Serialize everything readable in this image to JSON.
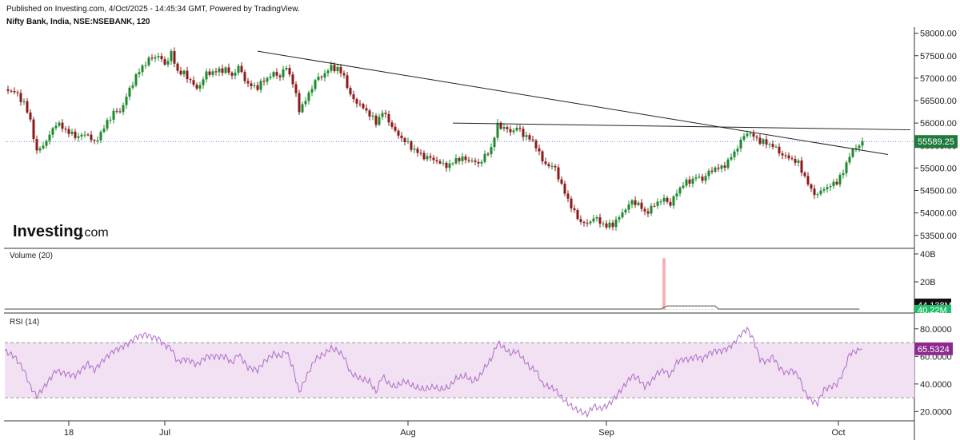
{
  "header": {
    "published": "Published on Investing.com, 4/Oct/2025 - 14:45:34 GMT, Powered by TradingView.",
    "symbol": "Nifty Bank, India, NSE:NSEBANK, 120"
  },
  "brand": {
    "name": "Investing",
    "suffix": ".com"
  },
  "colors": {
    "up": "#1e8a2e",
    "down": "#8b1a1a",
    "rsi_line": "#b06cc7",
    "rsi_band": "#f1e1f3",
    "price_line": "#3b6fd6",
    "last_price_bg": "#1e7b3a",
    "rsi_badge_bg": "#8e2a8e",
    "vol_badge_bg": "#111111",
    "vol_badge2_bg": "#1fbf6a",
    "volume_spike": "#f4b3b3"
  },
  "chart_data": [
    {
      "type": "candlestick",
      "title": "Nifty Bank, India, NSE:NSEBANK, 120",
      "ylim": [
        53300,
        58100
      ],
      "yticks": [
        "58000.00",
        "57500.00",
        "57000.00",
        "56500.00",
        "56000.00",
        "55500.00",
        "55000.00",
        "54500.00",
        "54000.00",
        "53500.00"
      ],
      "ytick_values": [
        58000,
        57500,
        57000,
        56500,
        56000,
        55500,
        55000,
        54500,
        54000,
        53500
      ],
      "last_price": 55589.25,
      "last_price_label": "55589.25",
      "close_path": [
        [
          0,
          56750
        ],
        [
          6,
          56700
        ],
        [
          12,
          56450
        ],
        [
          16,
          56050
        ],
        [
          20,
          55350
        ],
        [
          26,
          55600
        ],
        [
          32,
          56000
        ],
        [
          36,
          55900
        ],
        [
          44,
          55700
        ],
        [
          52,
          55750
        ],
        [
          56,
          55550
        ],
        [
          62,
          55900
        ],
        [
          68,
          56250
        ],
        [
          72,
          56250
        ],
        [
          78,
          56750
        ],
        [
          82,
          57050
        ],
        [
          88,
          57350
        ],
        [
          92,
          57450
        ],
        [
          96,
          57500
        ],
        [
          100,
          57300
        ],
        [
          104,
          57550
        ],
        [
          108,
          57150
        ],
        [
          112,
          57100
        ],
        [
          116,
          56950
        ],
        [
          120,
          56750
        ],
        [
          126,
          57100
        ],
        [
          132,
          57150
        ],
        [
          138,
          57200
        ],
        [
          142,
          57050
        ],
        [
          146,
          57250
        ],
        [
          152,
          56850
        ],
        [
          158,
          56800
        ],
        [
          162,
          56950
        ],
        [
          168,
          57100
        ],
        [
          172,
          57050
        ],
        [
          176,
          57250
        ],
        [
          180,
          56900
        ],
        [
          184,
          56300
        ],
        [
          188,
          56500
        ],
        [
          194,
          56950
        ],
        [
          200,
          57100
        ],
        [
          204,
          57250
        ],
        [
          208,
          57200
        ],
        [
          212,
          57050
        ],
        [
          216,
          56600
        ],
        [
          222,
          56400
        ],
        [
          228,
          56200
        ],
        [
          232,
          56000
        ],
        [
          236,
          56250
        ],
        [
          240,
          56050
        ],
        [
          244,
          55800
        ],
        [
          250,
          55600
        ],
        [
          256,
          55400
        ],
        [
          262,
          55250
        ],
        [
          268,
          55200
        ],
        [
          272,
          55100
        ],
        [
          278,
          55050
        ],
        [
          282,
          55200
        ],
        [
          288,
          55200
        ],
        [
          292,
          55150
        ],
        [
          296,
          55100
        ],
        [
          300,
          55250
        ],
        [
          304,
          55450
        ],
        [
          308,
          55950
        ],
        [
          312,
          55900
        ],
        [
          316,
          55800
        ],
        [
          320,
          55900
        ],
        [
          324,
          55750
        ],
        [
          328,
          55650
        ],
        [
          332,
          55500
        ],
        [
          336,
          55150
        ],
        [
          340,
          55050
        ],
        [
          344,
          55000
        ],
        [
          348,
          54600
        ],
        [
          352,
          54300
        ],
        [
          356,
          54000
        ],
        [
          360,
          53800
        ],
        [
          364,
          53750
        ],
        [
          368,
          53900
        ],
        [
          372,
          53800
        ],
        [
          376,
          53700
        ],
        [
          380,
          53750
        ],
        [
          384,
          53900
        ],
        [
          388,
          54100
        ],
        [
          392,
          54250
        ],
        [
          396,
          54200
        ],
        [
          400,
          54000
        ],
        [
          404,
          54100
        ],
        [
          408,
          54250
        ],
        [
          412,
          54300
        ],
        [
          416,
          54200
        ],
        [
          420,
          54450
        ],
        [
          424,
          54650
        ],
        [
          428,
          54700
        ],
        [
          432,
          54800
        ],
        [
          436,
          54750
        ],
        [
          440,
          54900
        ],
        [
          444,
          55000
        ],
        [
          448,
          55000
        ],
        [
          452,
          55150
        ],
        [
          456,
          55350
        ],
        [
          460,
          55600
        ],
        [
          464,
          55800
        ],
        [
          468,
          55700
        ],
        [
          472,
          55600
        ],
        [
          476,
          55550
        ],
        [
          480,
          55500
        ],
        [
          484,
          55350
        ],
        [
          488,
          55250
        ],
        [
          492,
          55200
        ],
        [
          496,
          55100
        ],
        [
          500,
          54800
        ],
        [
          504,
          54500
        ],
        [
          508,
          54400
        ],
        [
          512,
          54550
        ],
        [
          516,
          54600
        ],
        [
          520,
          54700
        ],
        [
          524,
          54900
        ],
        [
          528,
          55300
        ],
        [
          532,
          55450
        ],
        [
          536,
          55589
        ]
      ],
      "trendlines": [
        {
          "name": "descending-resistance",
          "from": [
            158,
            57600
          ],
          "to": [
            552,
            55300
          ]
        },
        {
          "name": "horizontal-resistance",
          "from": [
            280,
            56000
          ],
          "to": [
            566,
            55850
          ]
        }
      ]
    },
    {
      "type": "bar",
      "title": "Volume (20)",
      "ylim": [
        0,
        40
      ],
      "yticks": [
        "40B",
        "20B"
      ],
      "ytick_values": [
        40,
        20
      ],
      "unit": "B",
      "spike_x": 412,
      "spike_value": 37,
      "ma_step": [
        [
          0,
          0.6
        ],
        [
          410,
          0.6
        ],
        [
          414,
          2.8
        ],
        [
          444,
          2.8
        ],
        [
          446,
          0.6
        ],
        [
          534,
          0.6
        ]
      ],
      "last_volume": "44.138M",
      "volume_ma": "40.22M"
    },
    {
      "type": "line",
      "title": "RSI (14)",
      "ylim": [
        15,
        88
      ],
      "yticks": [
        "80.0000",
        "60.0000",
        "40.0000",
        "20.0000"
      ],
      "ytick_values": [
        80,
        60,
        40,
        20
      ],
      "band": [
        30,
        70
      ],
      "last_value": 65.5324,
      "last_value_label": "65.5324",
      "values": [
        [
          0,
          64
        ],
        [
          6,
          60
        ],
        [
          12,
          50
        ],
        [
          16,
          38
        ],
        [
          20,
          31
        ],
        [
          26,
          40
        ],
        [
          32,
          50
        ],
        [
          36,
          48
        ],
        [
          44,
          46
        ],
        [
          52,
          55
        ],
        [
          56,
          50
        ],
        [
          62,
          58
        ],
        [
          68,
          64
        ],
        [
          72,
          66
        ],
        [
          78,
          70
        ],
        [
          82,
          74
        ],
        [
          88,
          76
        ],
        [
          92,
          74
        ],
        [
          96,
          73
        ],
        [
          100,
          68
        ],
        [
          104,
          66
        ],
        [
          108,
          56
        ],
        [
          112,
          58
        ],
        [
          116,
          57
        ],
        [
          120,
          54
        ],
        [
          126,
          60
        ],
        [
          132,
          60
        ],
        [
          138,
          60
        ],
        [
          142,
          55
        ],
        [
          146,
          62
        ],
        [
          152,
          52
        ],
        [
          158,
          50
        ],
        [
          162,
          56
        ],
        [
          168,
          62
        ],
        [
          172,
          60
        ],
        [
          176,
          64
        ],
        [
          180,
          52
        ],
        [
          184,
          34
        ],
        [
          188,
          44
        ],
        [
          194,
          58
        ],
        [
          200,
          62
        ],
        [
          204,
          66
        ],
        [
          208,
          64
        ],
        [
          212,
          60
        ],
        [
          216,
          48
        ],
        [
          222,
          44
        ],
        [
          228,
          42
        ],
        [
          232,
          34
        ],
        [
          236,
          46
        ],
        [
          240,
          40
        ],
        [
          244,
          38
        ],
        [
          250,
          42
        ],
        [
          256,
          38
        ],
        [
          262,
          36
        ],
        [
          268,
          38
        ],
        [
          272,
          36
        ],
        [
          278,
          38
        ],
        [
          282,
          44
        ],
        [
          288,
          46
        ],
        [
          292,
          42
        ],
        [
          296,
          44
        ],
        [
          300,
          52
        ],
        [
          304,
          58
        ],
        [
          308,
          70
        ],
        [
          312,
          66
        ],
        [
          316,
          62
        ],
        [
          320,
          64
        ],
        [
          324,
          58
        ],
        [
          328,
          52
        ],
        [
          332,
          50
        ],
        [
          336,
          40
        ],
        [
          340,
          38
        ],
        [
          344,
          36
        ],
        [
          348,
          30
        ],
        [
          352,
          26
        ],
        [
          356,
          22
        ],
        [
          360,
          20
        ],
        [
          364,
          18
        ],
        [
          368,
          24
        ],
        [
          372,
          22
        ],
        [
          376,
          24
        ],
        [
          380,
          28
        ],
        [
          384,
          34
        ],
        [
          388,
          40
        ],
        [
          392,
          46
        ],
        [
          396,
          44
        ],
        [
          400,
          38
        ],
        [
          404,
          42
        ],
        [
          408,
          48
        ],
        [
          412,
          50
        ],
        [
          416,
          46
        ],
        [
          420,
          56
        ],
        [
          424,
          58
        ],
        [
          428,
          58
        ],
        [
          432,
          60
        ],
        [
          436,
          58
        ],
        [
          440,
          62
        ],
        [
          444,
          64
        ],
        [
          448,
          64
        ],
        [
          452,
          66
        ],
        [
          456,
          70
        ],
        [
          460,
          76
        ],
        [
          464,
          80
        ],
        [
          468,
          72
        ],
        [
          472,
          58
        ],
        [
          476,
          56
        ],
        [
          480,
          60
        ],
        [
          484,
          52
        ],
        [
          488,
          48
        ],
        [
          492,
          50
        ],
        [
          496,
          46
        ],
        [
          500,
          34
        ],
        [
          504,
          28
        ],
        [
          508,
          26
        ],
        [
          512,
          36
        ],
        [
          516,
          38
        ],
        [
          520,
          40
        ],
        [
          524,
          48
        ],
        [
          528,
          62
        ],
        [
          532,
          64
        ],
        [
          536,
          65.5
        ]
      ]
    }
  ],
  "x_axis": {
    "span": [
      0,
      566
    ],
    "ticks": [
      {
        "label": "18",
        "x": 40
      },
      {
        "label": "Jul",
        "x": 100
      },
      {
        "label": "Aug",
        "x": 252
      },
      {
        "label": "Sep",
        "x": 376
      },
      {
        "label": "Oct",
        "x": 521
      }
    ]
  }
}
